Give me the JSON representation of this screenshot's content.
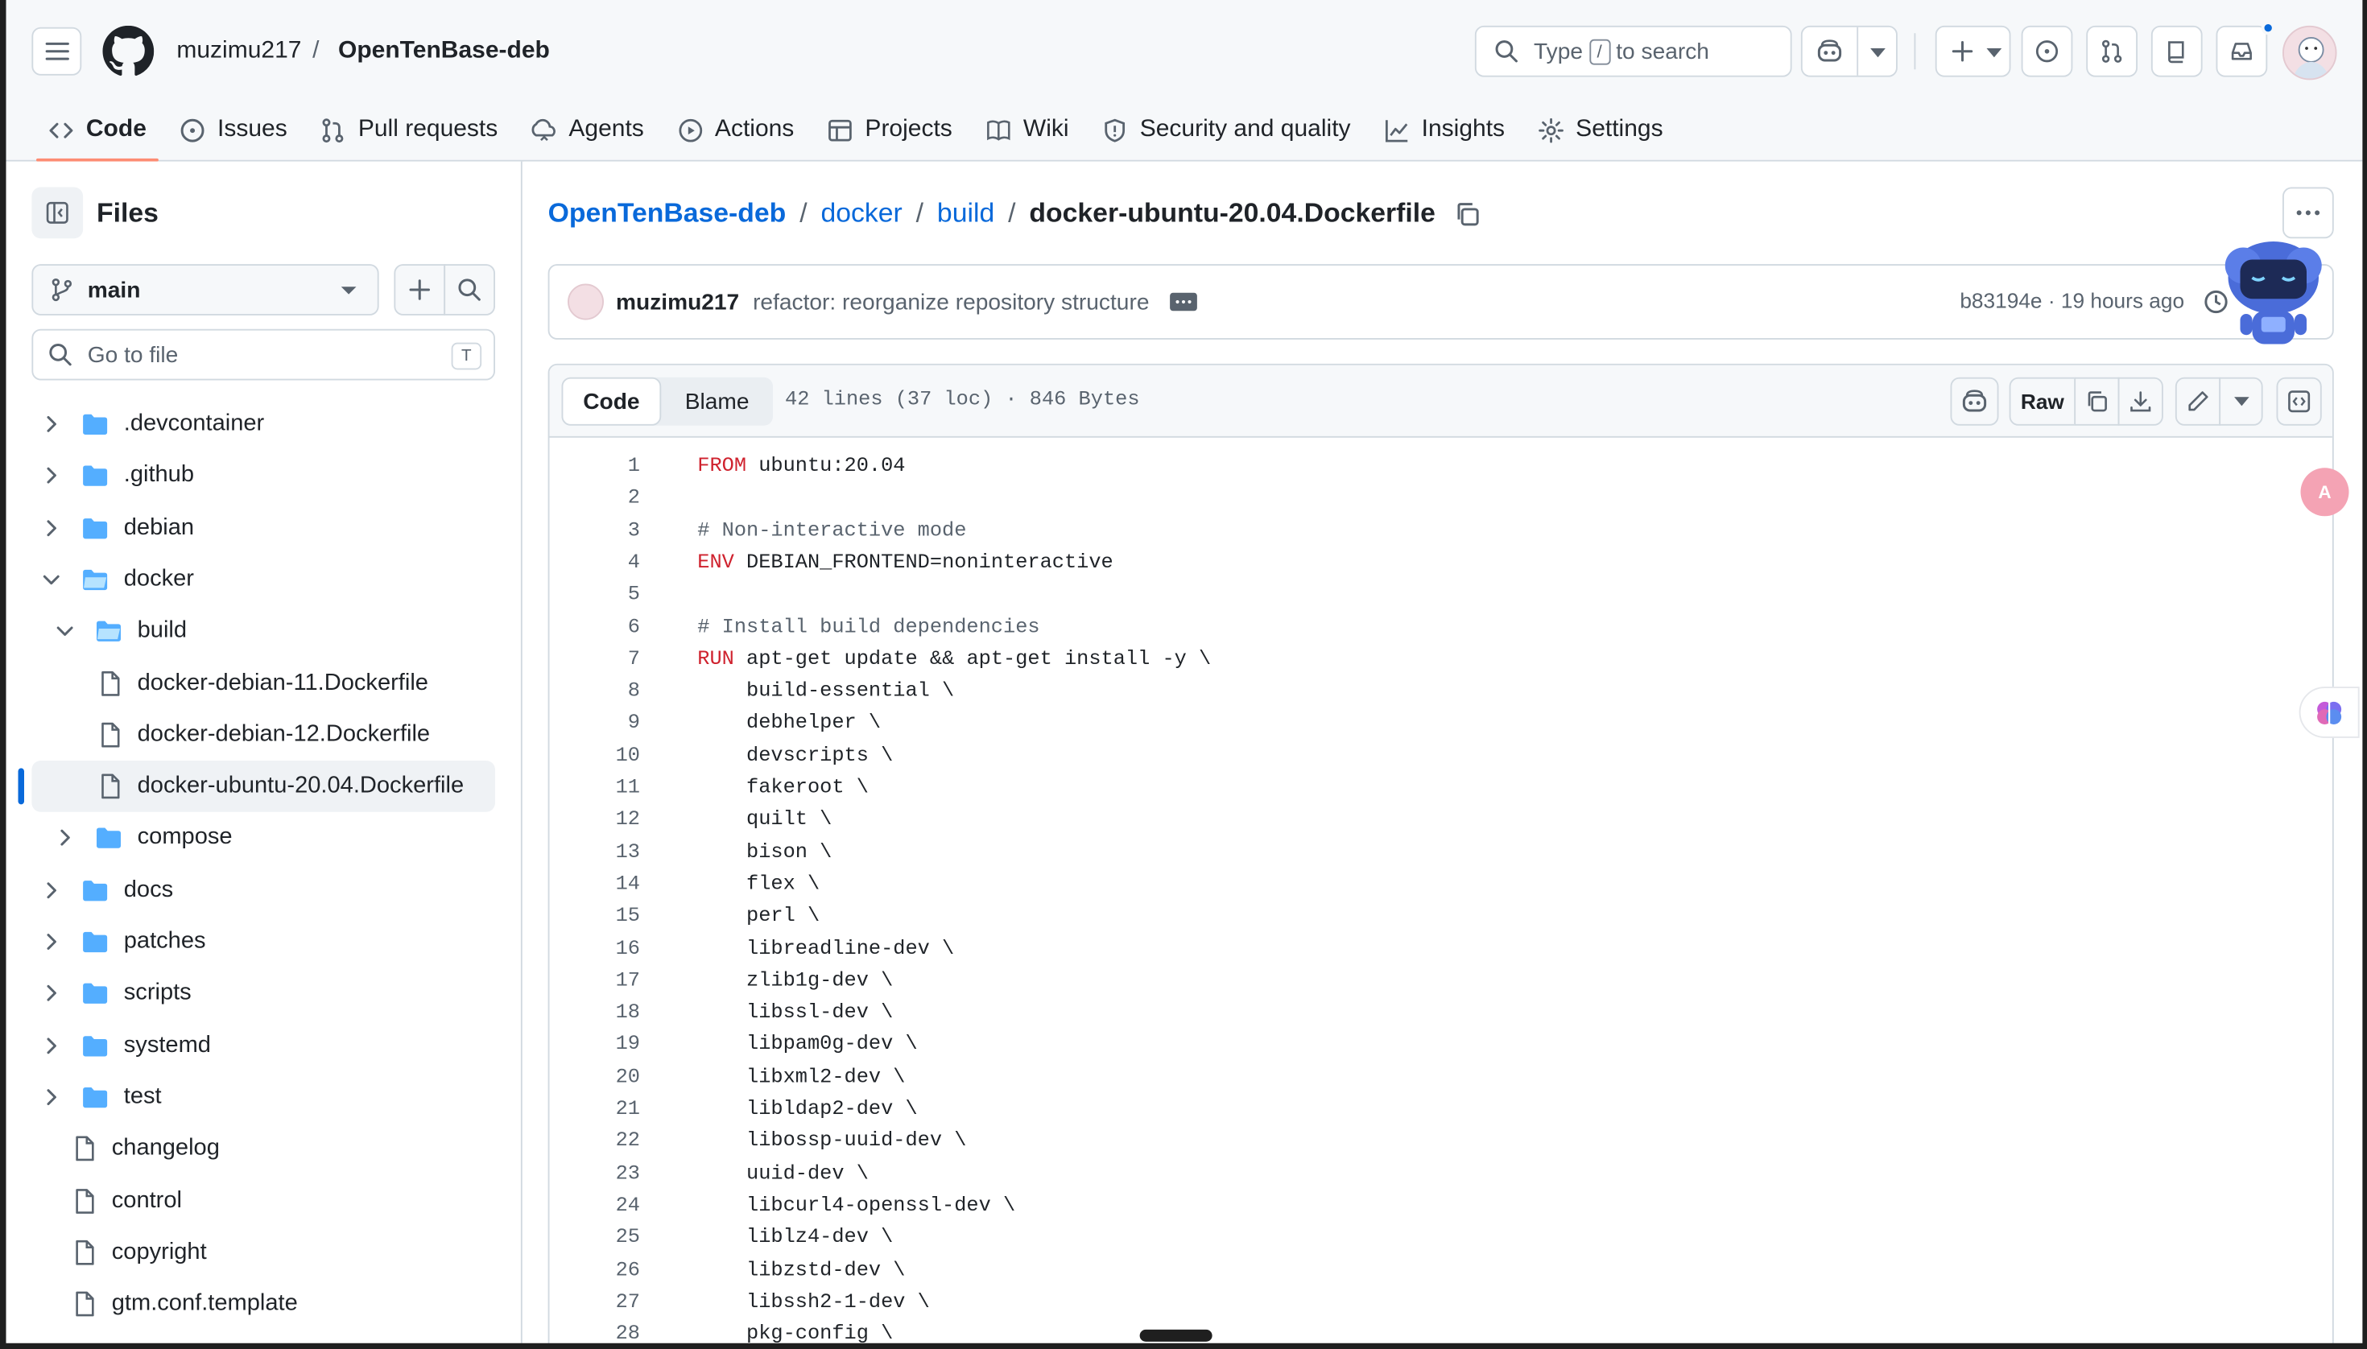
{
  "header": {
    "owner": "muzimu217",
    "separator": "/",
    "repo": "OpenTenBase-deb",
    "search_prefix": "Type",
    "search_kbd": "/",
    "search_suffix": "to search"
  },
  "repo_nav": {
    "tabs": [
      {
        "label": "Code",
        "icon": "code-icon",
        "active": true
      },
      {
        "label": "Issues",
        "icon": "issue-opened-icon"
      },
      {
        "label": "Pull requests",
        "icon": "git-pull-request-icon"
      },
      {
        "label": "Agents",
        "icon": "agent-icon"
      },
      {
        "label": "Actions",
        "icon": "play-icon"
      },
      {
        "label": "Projects",
        "icon": "table-icon"
      },
      {
        "label": "Wiki",
        "icon": "book-icon"
      },
      {
        "label": "Security and quality",
        "icon": "shield-icon"
      },
      {
        "label": "Insights",
        "icon": "graph-icon"
      },
      {
        "label": "Settings",
        "icon": "gear-icon"
      }
    ]
  },
  "sidebar": {
    "title": "Files",
    "branch": "main",
    "goto_placeholder": "Go to file",
    "goto_kbd": "T",
    "tree": [
      {
        "name": ".devcontainer",
        "type": "folder",
        "depth": 0,
        "expanded": false
      },
      {
        "name": ".github",
        "type": "folder",
        "depth": 0,
        "expanded": false
      },
      {
        "name": "debian",
        "type": "folder",
        "depth": 0,
        "expanded": false
      },
      {
        "name": "docker",
        "type": "folder",
        "depth": 0,
        "expanded": true
      },
      {
        "name": "build",
        "type": "folder",
        "depth": 1,
        "expanded": true
      },
      {
        "name": "docker-debian-11.Dockerfile",
        "type": "file",
        "depth": 2
      },
      {
        "name": "docker-debian-12.Dockerfile",
        "type": "file",
        "depth": 2
      },
      {
        "name": "docker-ubuntu-20.04.Dockerfile",
        "type": "file",
        "depth": 2,
        "selected": true
      },
      {
        "name": "compose",
        "type": "folder",
        "depth": 1,
        "expanded": false
      },
      {
        "name": "docs",
        "type": "folder",
        "depth": 0,
        "expanded": false
      },
      {
        "name": "patches",
        "type": "folder",
        "depth": 0,
        "expanded": false
      },
      {
        "name": "scripts",
        "type": "folder",
        "depth": 0,
        "expanded": false
      },
      {
        "name": "systemd",
        "type": "folder",
        "depth": 0,
        "expanded": false
      },
      {
        "name": "test",
        "type": "folder",
        "depth": 0,
        "expanded": false
      },
      {
        "name": "changelog",
        "type": "file",
        "depth": 0
      },
      {
        "name": "control",
        "type": "file",
        "depth": 0
      },
      {
        "name": "copyright",
        "type": "file",
        "depth": 0
      },
      {
        "name": "gtm.conf.template",
        "type": "file",
        "depth": 0
      }
    ]
  },
  "breadcrumb": {
    "parts": [
      "OpenTenBase-deb",
      "docker",
      "build"
    ],
    "current": "docker-ubuntu-20.04.Dockerfile"
  },
  "commit": {
    "author": "muzimu217",
    "message": "refactor: reorganize repository structure",
    "sha_time": "b83194e · 19 hours ago"
  },
  "file": {
    "tab_code": "Code",
    "tab_blame": "Blame",
    "meta": "42 lines (37 loc) · 846 Bytes",
    "raw_label": "Raw",
    "lines": [
      {
        "n": "1",
        "kw": "FROM",
        "text": " ubuntu:20.04"
      },
      {
        "n": "2",
        "text": ""
      },
      {
        "n": "3",
        "comment": "# Non-interactive mode"
      },
      {
        "n": "4",
        "kw": "ENV",
        "text": " DEBIAN_FRONTEND=noninteractive"
      },
      {
        "n": "5",
        "text": ""
      },
      {
        "n": "6",
        "comment": "# Install build dependencies"
      },
      {
        "n": "7",
        "kw": "RUN",
        "text": " apt-get update && apt-get install -y \\"
      },
      {
        "n": "8",
        "text": "    build-essential \\"
      },
      {
        "n": "9",
        "text": "    debhelper \\"
      },
      {
        "n": "10",
        "text": "    devscripts \\"
      },
      {
        "n": "11",
        "text": "    fakeroot \\"
      },
      {
        "n": "12",
        "text": "    quilt \\"
      },
      {
        "n": "13",
        "text": "    bison \\"
      },
      {
        "n": "14",
        "text": "    flex \\"
      },
      {
        "n": "15",
        "text": "    perl \\"
      },
      {
        "n": "16",
        "text": "    libreadline-dev \\"
      },
      {
        "n": "17",
        "text": "    zlib1g-dev \\"
      },
      {
        "n": "18",
        "text": "    libssl-dev \\"
      },
      {
        "n": "19",
        "text": "    libpam0g-dev \\"
      },
      {
        "n": "20",
        "text": "    libxml2-dev \\"
      },
      {
        "n": "21",
        "text": "    libldap2-dev \\"
      },
      {
        "n": "22",
        "text": "    libossp-uuid-dev \\"
      },
      {
        "n": "23",
        "text": "    uuid-dev \\"
      },
      {
        "n": "24",
        "text": "    libcurl4-openssl-dev \\"
      },
      {
        "n": "25",
        "text": "    liblz4-dev \\"
      },
      {
        "n": "26",
        "text": "    libzstd-dev \\"
      },
      {
        "n": "27",
        "text": "    libssh2-1-dev \\"
      },
      {
        "n": "28",
        "text": "    pkg-config \\"
      }
    ]
  },
  "floating": {
    "translate_label": "A"
  },
  "colors": {
    "accent": "#0969da",
    "tab_underline": "#fd8c73",
    "keyword": "#cf222e",
    "folder": "#54aeff"
  }
}
